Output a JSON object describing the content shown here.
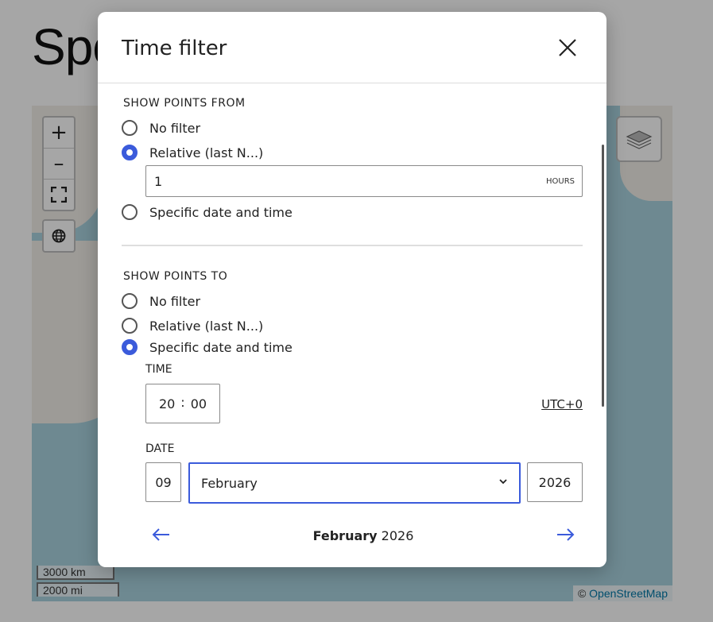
{
  "page": {
    "heading": "Spo"
  },
  "map": {
    "zoom_in_label": "+",
    "zoom_out_label": "–",
    "scale_km": "3000 km",
    "scale_mi": "2000 mi",
    "attribution_prefix": "©",
    "attribution_link": "OpenStreetMap",
    "colors": {
      "water": "#aad3df",
      "land": "#f2efe9"
    }
  },
  "modal": {
    "title": "Time filter",
    "from": {
      "section_title": "SHOW POINTS FROM",
      "options": [
        {
          "label": "No filter",
          "checked": false
        },
        {
          "label": "Relative (last N...)",
          "checked": true
        },
        {
          "label": "Specific date and time",
          "checked": false
        }
      ],
      "relative_value": "1",
      "relative_unit": "HOURS"
    },
    "to": {
      "section_title": "SHOW POINTS TO",
      "options": [
        {
          "label": "No filter",
          "checked": false
        },
        {
          "label": "Relative (last N...)",
          "checked": false
        },
        {
          "label": "Specific date and time",
          "checked": true
        }
      ],
      "time_label": "TIME",
      "hour": "20",
      "minute": "00",
      "time_sep": ":",
      "timezone": "UTC+0",
      "date_label": "DATE",
      "day": "09",
      "month": "February",
      "year": "2026"
    },
    "calendar": {
      "month": "February",
      "year": "2026"
    },
    "colors": {
      "accent": "#3b5bdb"
    }
  }
}
